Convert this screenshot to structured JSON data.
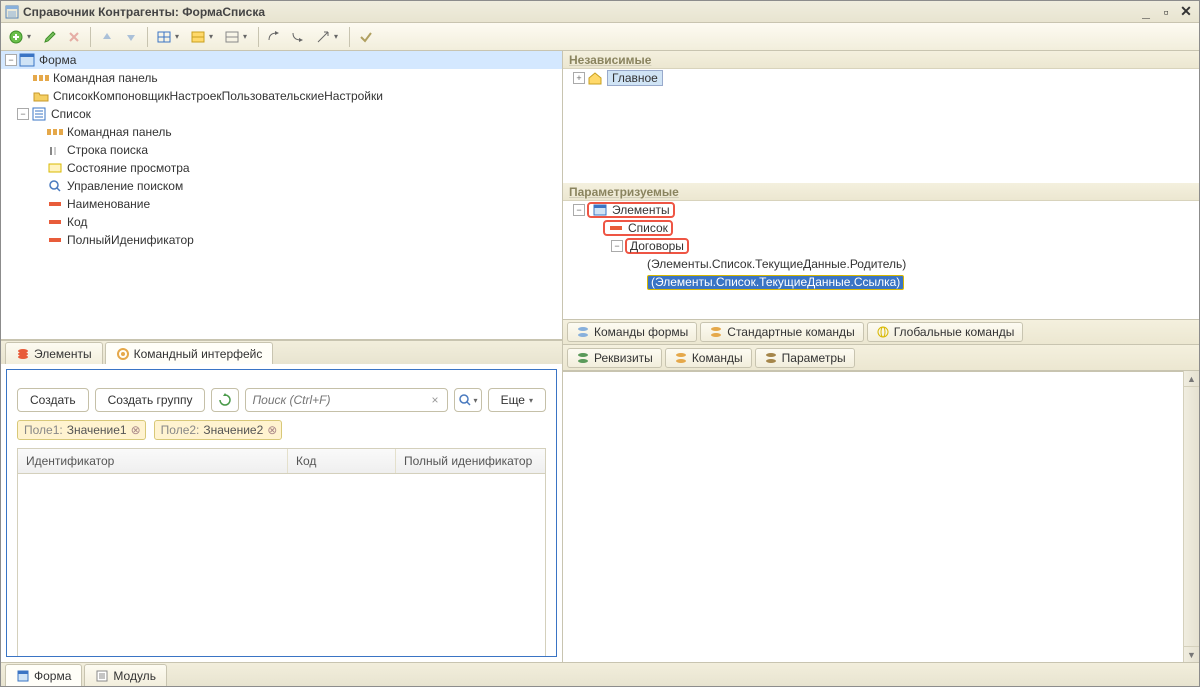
{
  "window": {
    "title": "Справочник Контрагенты: ФормаСписка"
  },
  "left_tree": {
    "root": "Форма",
    "items": [
      {
        "indent": 1,
        "icon": "cmdbar",
        "label": "Командная панель"
      },
      {
        "indent": 1,
        "icon": "folder",
        "label": "СписокКомпоновщикНастроекПользовательскиеНастройки"
      }
    ],
    "list_node": "Список",
    "list_children": [
      {
        "icon": "cmdbar",
        "label": "Командная панель"
      },
      {
        "icon": "searchrow",
        "label": "Строка поиска"
      },
      {
        "icon": "viewstate",
        "label": "Состояние просмотра"
      },
      {
        "icon": "searchmgmt",
        "label": "Управление поиском"
      },
      {
        "icon": "field",
        "label": "Наименование"
      },
      {
        "icon": "field",
        "label": "Код"
      },
      {
        "icon": "field",
        "label": "ПолныйИденификатор"
      }
    ]
  },
  "left_tabs": {
    "elements": "Элементы",
    "cmd_interface": "Командный интерфейс"
  },
  "right": {
    "group1": "Независимые",
    "group1_item": "Главное",
    "group2": "Параметризуемые",
    "group2_items": {
      "elements": "Элементы",
      "list": "Список",
      "contracts": "Договоры",
      "parent_ref": "(Элементы.Список.ТекущиеДанные.Родитель)",
      "link_ref": "(Элементы.Список.ТекущиеДанные.Ссылка)"
    }
  },
  "cmd_tabs1": {
    "a": "Команды формы",
    "b": "Стандартные команды",
    "c": "Глобальные команды"
  },
  "cmd_tabs2": {
    "a": "Реквизиты",
    "b": "Команды",
    "c": "Параметры"
  },
  "preview": {
    "btn_create": "Создать",
    "btn_create_group": "Создать группу",
    "search_placeholder": "Поиск (Ctrl+F)",
    "btn_more": "Еще",
    "filters": [
      {
        "label": "Поле1:",
        "value": "Значение1"
      },
      {
        "label": "Поле2:",
        "value": "Значение2"
      }
    ],
    "columns": {
      "c1": "Идентификатор",
      "c2": "Код",
      "c3": "Полный иденификатор"
    }
  },
  "bottom_tabs": {
    "form": "Форма",
    "module": "Модуль"
  }
}
